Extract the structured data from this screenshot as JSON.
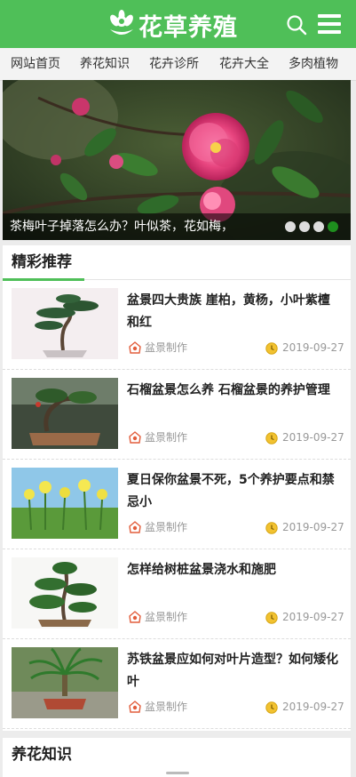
{
  "site": {
    "logo_text": "花草养殖",
    "brand_color": "#4fbf58"
  },
  "nav": {
    "items": [
      "网站首页",
      "养花知识",
      "花卉诊所",
      "花卉大全",
      "多肉植物"
    ]
  },
  "banner": {
    "title": "茶梅叶子掉落怎么办？叶似茶，花如梅，",
    "slide_count": 4,
    "active_slide": 4
  },
  "recommend": {
    "title": "精彩推荐",
    "articles": [
      {
        "title": "盆景四大贵族 崖柏，黄杨，小叶紫檀和红",
        "category": "盆景制作",
        "date": "2019-09-27"
      },
      {
        "title": "石榴盆景怎么养 石榴盆景的养护管理",
        "category": "盆景制作",
        "date": "2019-09-27"
      },
      {
        "title": "夏日保你盆景不死，5个养护要点和禁忌小",
        "category": "盆景制作",
        "date": "2019-09-27"
      },
      {
        "title": "怎样给树桩盆景浇水和施肥",
        "category": "盆景制作",
        "date": "2019-09-27"
      },
      {
        "title": "苏铁盆景应如何对叶片造型？如何矮化叶",
        "category": "盆景制作",
        "date": "2019-09-27"
      }
    ]
  },
  "knowledge": {
    "title": "养花知识"
  },
  "icons": {
    "search": "search-icon",
    "menu": "menu-icon",
    "category": "bonsai-category-icon",
    "date": "clock-icon"
  }
}
